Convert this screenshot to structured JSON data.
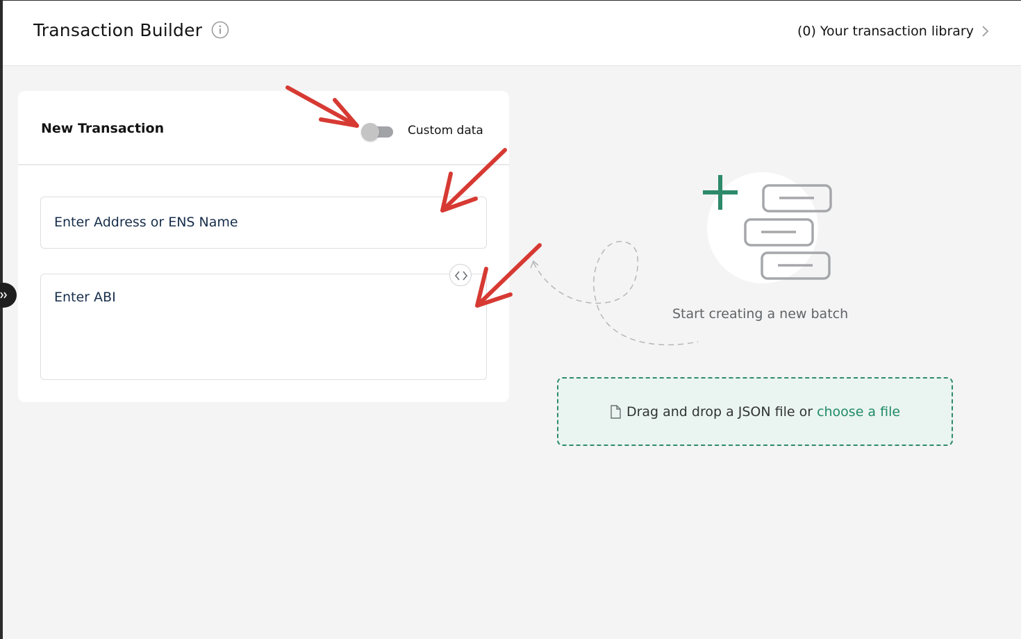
{
  "header": {
    "title": "Transaction Builder",
    "library_link": "(0) Your transaction library"
  },
  "card": {
    "title": "New Transaction",
    "toggle_label": "Custom data",
    "toggle_on": false,
    "address_placeholder": "Enter Address or ENS Name",
    "abi_placeholder": "Enter ABI"
  },
  "empty_state": {
    "text": "Start creating a new batch"
  },
  "dropzone": {
    "text": "Drag and drop a JSON file or",
    "link": "choose a file"
  },
  "icons": {
    "info": "info-icon",
    "chevron": "chevron-right-icon",
    "sidebar": "double-chevron-right-icon",
    "code": "code-icon",
    "file": "file-icon",
    "plus": "plus-icon"
  },
  "colors": {
    "accent": "#2d8a6a",
    "annotation": "#d63a33",
    "background": "#f4f4f4"
  }
}
